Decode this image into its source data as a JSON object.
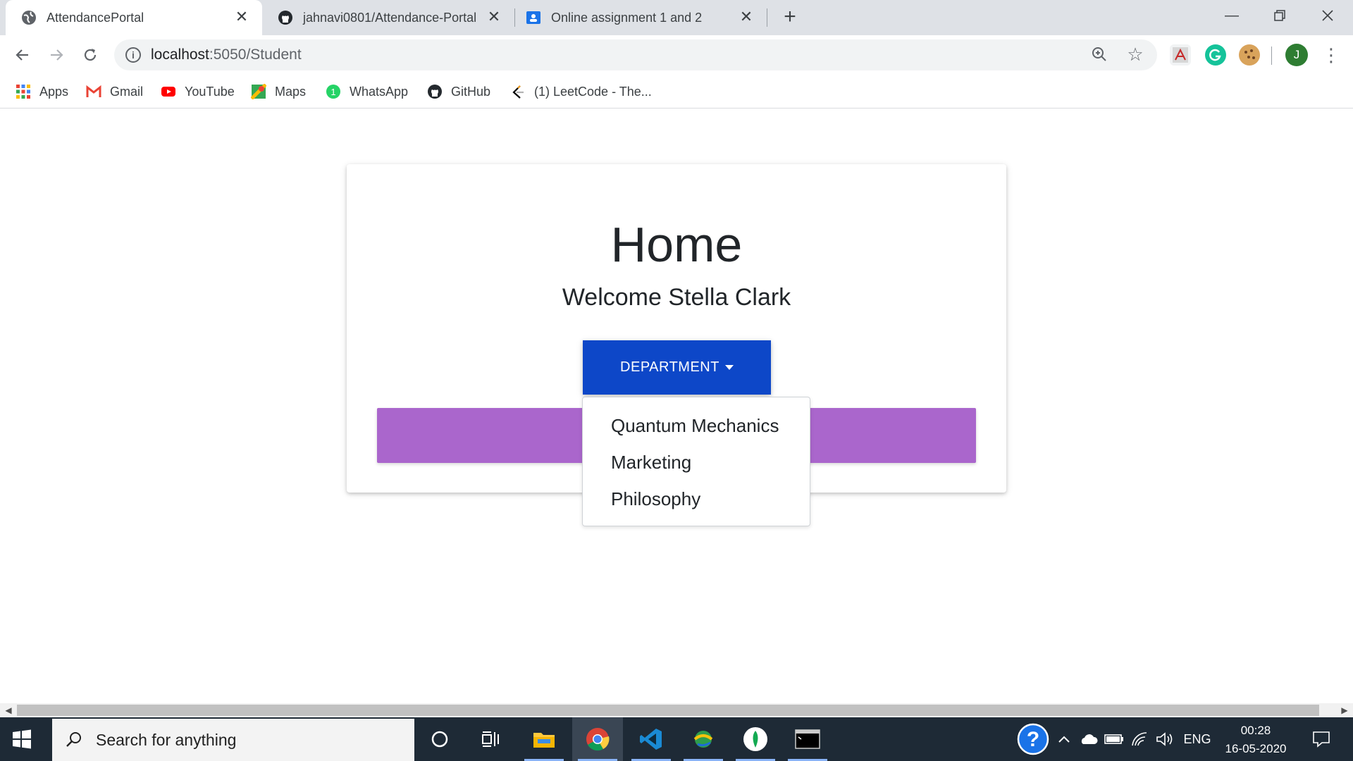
{
  "browser": {
    "tabs": [
      {
        "title": "AttendancePortal",
        "favicon": "globe-icon",
        "active": true
      },
      {
        "title": "jahnavi0801/Attendance-Portal",
        "favicon": "github-icon",
        "active": false
      },
      {
        "title": "Online assignment 1 and 2",
        "favicon": "classroom-icon",
        "active": false
      }
    ],
    "close_glyph": "✕",
    "new_tab_glyph": "+",
    "url_host": "localhost",
    "url_path": ":5050/Student",
    "bookmarks": [
      {
        "label": "Apps",
        "icon": "apps-grid-icon"
      },
      {
        "label": "Gmail",
        "icon": "gmail-icon"
      },
      {
        "label": "YouTube",
        "icon": "youtube-icon"
      },
      {
        "label": "Maps",
        "icon": "maps-icon"
      },
      {
        "label": "WhatsApp",
        "icon": "whatsapp-icon"
      },
      {
        "label": "GitHub",
        "icon": "github-icon"
      },
      {
        "label": "(1) LeetCode - The...",
        "icon": "leetcode-icon"
      }
    ],
    "avatar_initial": "J"
  },
  "page": {
    "title": "Home",
    "welcome": "Welcome Stella Clark",
    "department_button": "DEPARTMENT",
    "department_menu": [
      "Quantum Mechanics",
      "Marketing",
      "Philosophy"
    ],
    "colors": {
      "primary_button": "#0d47c8",
      "purple_bar": "#aa66cc"
    }
  },
  "taskbar": {
    "search_placeholder": "Search for anything",
    "language": "ENG",
    "time": "00:28",
    "date": "16-05-2020"
  }
}
